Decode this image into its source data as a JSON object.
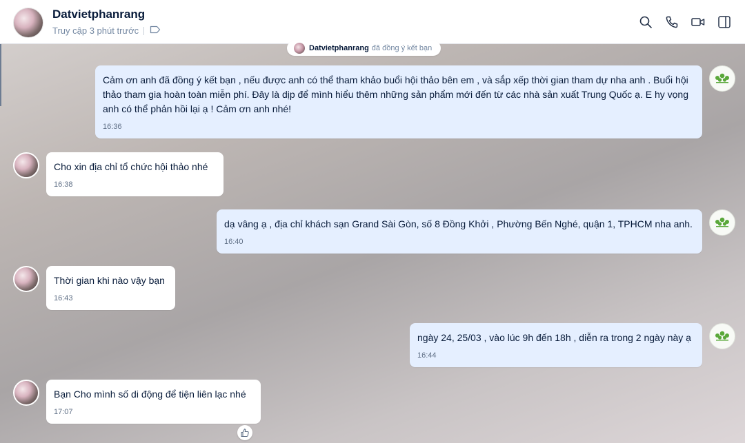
{
  "header": {
    "name": "Datvietphanrang",
    "status": "Truy cập 3 phút trước",
    "icons": [
      "search-icon",
      "phone-icon",
      "video-icon",
      "sidebar-toggle-icon"
    ]
  },
  "system_notice": {
    "name": "Datvietphanrang",
    "text": "đã đồng ý kết bạn"
  },
  "messages": [
    {
      "from": "me",
      "text": "Cảm ơn anh đã đồng ý kết bạn , nếu được anh có thể tham khảo buổi hội thảo bên em , và sắp xếp thời gian tham dự nha anh . Buổi hội thảo tham gia hoàn toàn miễn phí.  Đây là dịp để mình hiểu thêm những sản phẩm mới đến từ các nhà sản xuất Trung Quốc ạ. E hy vọng anh có thể phản hồi lại ạ ! Cảm ơn anh nhé!",
      "time": "16:36"
    },
    {
      "from": "them",
      "text": "Cho xin địa chỉ tổ chức hội thảo nhé",
      "time": "16:38"
    },
    {
      "from": "me",
      "text": "dạ vâng ạ , địa chỉ khách sạn Grand Sài Gòn, số 8 Đồng Khởi , Phường Bến Nghé, quận 1,   TPHCM nha anh.",
      "time": "16:40"
    },
    {
      "from": "them",
      "text": "Thời gian khi nào vậy bạn",
      "time": "16:43"
    },
    {
      "from": "me",
      "text": "ngày 24, 25/03 , vào lúc 9h đến 18h , diễn ra trong 2 ngày này ạ",
      "time": "16:44"
    },
    {
      "from": "them",
      "text": "Bạn Cho mình số di động để tiện liên lạc nhé",
      "time": "17:07"
    }
  ],
  "colors": {
    "my_bubble": "#e5efff",
    "their_bubble": "#ffffff",
    "primary_text": "#081b3a",
    "secondary_text": "#7589a3"
  }
}
